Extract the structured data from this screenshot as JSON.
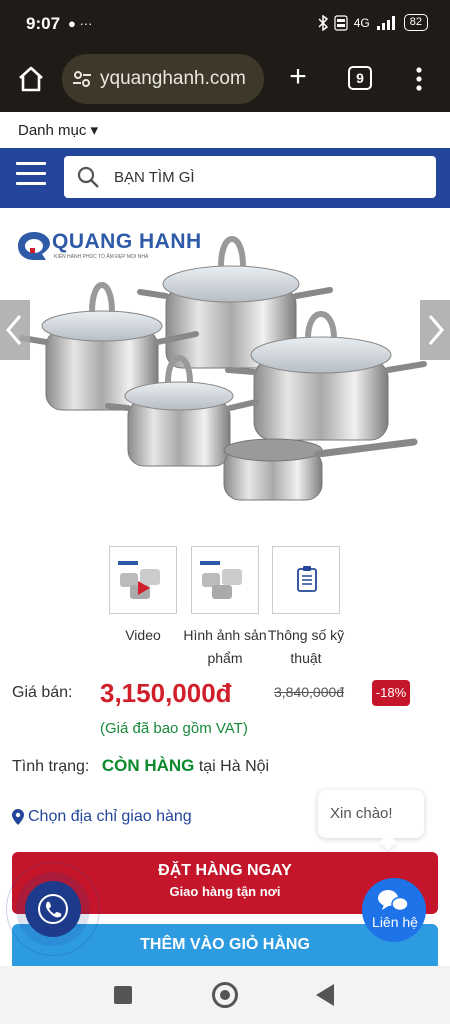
{
  "status_bar": {
    "time": "9:07",
    "left_icons": "● ···",
    "network": "4G",
    "battery": "82"
  },
  "browser": {
    "url": "yquanghanh.com",
    "tab_count": "9"
  },
  "category": {
    "label": "Danh mục ▾"
  },
  "search": {
    "placeholder": "BẠN TÌM GÌ"
  },
  "brand": {
    "name": "QUANG HANH",
    "tagline": "KIẾN HÀNH PHÚC TỔ ẤM ĐẸP MỌI NHÀ"
  },
  "thumbnails": [
    {
      "label": "Video"
    },
    {
      "label": "Hình ảnh sản phẩm"
    },
    {
      "label": "Thông số kỹ thuật"
    }
  ],
  "price": {
    "label": "Giá bán:",
    "current": "3,150,000đ",
    "old": "3,840,000đ",
    "discount": "-18%",
    "vat_note": "(Giá đã bao gồm VAT)"
  },
  "stock": {
    "label": "Tình trạng:",
    "value": "CÒN HÀNG",
    "location": " tại Hà Nội"
  },
  "address": {
    "label": "Chọn địa chỉ giao hàng"
  },
  "chat": {
    "greeting": "Xin chào!",
    "contact_label": "Liên hệ"
  },
  "order_button": {
    "title": "ĐẶT HÀNG NGAY",
    "subtitle": "Giao hàng tận nơi"
  },
  "cart_button": {
    "title": "THÊM VÀO GIỎ HÀNG"
  },
  "colors": {
    "brand_blue": "#24469a",
    "price_red": "#d01f2b",
    "stock_green": "#0a8a2a",
    "cart_blue": "#2c9be0"
  }
}
